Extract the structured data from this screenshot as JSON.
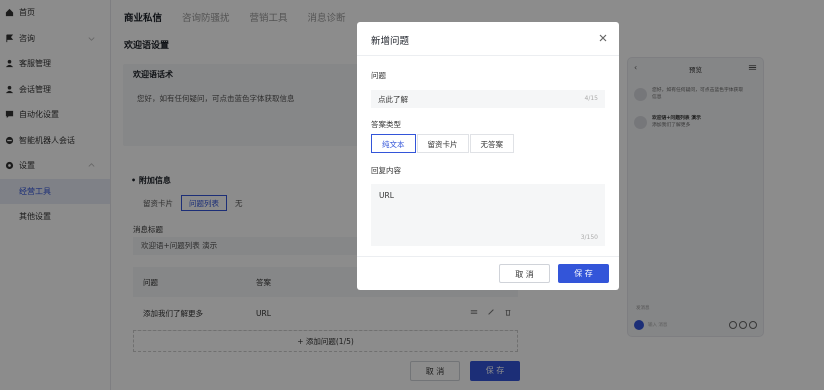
{
  "sidebar": {
    "items": [
      {
        "label": "首页"
      },
      {
        "label": "咨询"
      },
      {
        "label": "客服管理"
      },
      {
        "label": "会话管理"
      },
      {
        "label": "自动化设置"
      },
      {
        "label": "智能机器人会话"
      },
      {
        "label": "设置"
      },
      {
        "label": "经营工具"
      },
      {
        "label": "其他设置"
      }
    ]
  },
  "tabs": [
    "商业私信",
    "咨询防骚扰",
    "营销工具",
    "消息诊断"
  ],
  "main": {
    "section_title": "欢迎语设置",
    "welcome_label": "欢迎语话术",
    "welcome_text": "您好，如有任何疑问，可点击蓝色字体获取信息",
    "extra_label": "附加信息",
    "extra_options": [
      "留资卡片",
      "问题列表",
      "无"
    ],
    "msg_title_label": "消息标题",
    "msg_title_value": "欢迎语+问题列表 演示",
    "table_headers": [
      "问题",
      "答案"
    ],
    "rows": [
      {
        "q": "添加我们了解更多",
        "a": "URL"
      }
    ],
    "add_question": "+ 添加问题(1/5)",
    "cancel": "取 消",
    "save": "保 存"
  },
  "preview": {
    "title": "预览",
    "msg1": "您好，如有任何疑问，可点击蓝色字体获取信息",
    "msg2_title": "欢迎语+问题列表 演示",
    "msg2_item": "添加我们了解更多",
    "quick": "发消息",
    "input_placeholder": "输入 消息"
  },
  "modal": {
    "title": "新增问题",
    "question_label": "问题",
    "question_value": "点此了解",
    "question_count": "4/15",
    "answer_type_label": "答案类型",
    "answer_types": [
      "纯文本",
      "留资卡片",
      "无答案"
    ],
    "reply_label": "回复内容",
    "reply_value": "URL",
    "reply_count": "3/150",
    "cancel": "取 消",
    "save": "保 存"
  },
  "colors": {
    "primary": "#3355d9",
    "overlay": "rgba(0,0,0,0.45)"
  }
}
